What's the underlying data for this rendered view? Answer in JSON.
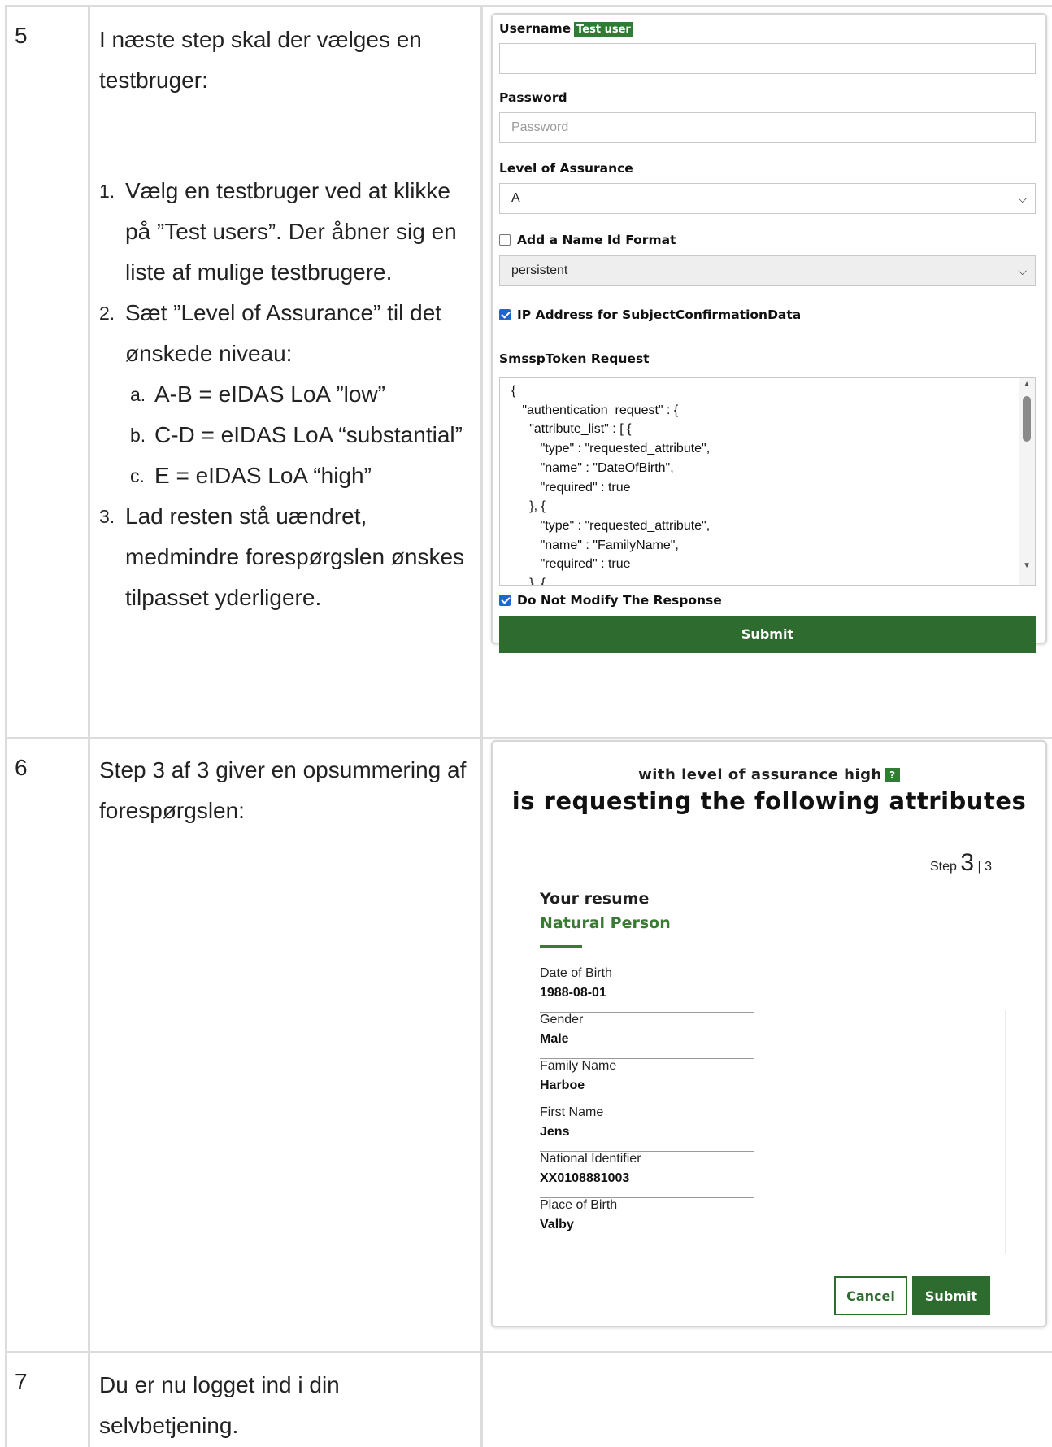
{
  "rows": [
    {
      "number": "5",
      "intro": "I næste step skal der vælges en testbruger:",
      "steps": [
        {
          "marker": "1.",
          "text": "Vælg en testbruger ved at klikke på ”Test users”. Der åbner sig en liste af mulige testbrugere."
        },
        {
          "marker": "2.",
          "text": "Sæt ”Level of Assurance” til det ønskede niveau:"
        },
        {
          "marker": "a.",
          "text": "A-B = eIDAS LoA ”low”"
        },
        {
          "marker": "b.",
          "text": "C-D = eIDAS LoA “substantial”"
        },
        {
          "marker": "c.",
          "text": "E = eIDAS LoA “high”"
        },
        {
          "marker": "3.",
          "text": "Lad resten stå uændret, medmindre forespørgslen ønskes tilpasset yderligere."
        }
      ]
    },
    {
      "number": "6",
      "intro": "Step 3 af 3 giver en opsummering af forespørgslen:"
    },
    {
      "number": "7",
      "intro": "Du er nu logget ind i din selvbetjening."
    }
  ],
  "login_form": {
    "username_label": "Username",
    "test_user_badge": "Test user",
    "username_value": "",
    "password_label": "Password",
    "password_placeholder": "Password",
    "loa_label": "Level of Assurance",
    "loa_value": "A",
    "name_id_label": "Add a Name Id Format",
    "name_id_checked": false,
    "name_id_value": "persistent",
    "ip_label": "IP Address for SubjectConfirmationData",
    "ip_checked": true,
    "token_label": "SmsspToken Request",
    "token_json": "{\n   \"authentication_request\" : {\n     \"attribute_list\" : [ {\n        \"type\" : \"requested_attribute\",\n        \"name\" : \"DateOfBirth\",\n        \"required\" : true\n     }, {\n        \"type\" : \"requested_attribute\",\n        \"name\" : \"FamilyName\",\n        \"required\" : true\n     }, {",
    "no_modify_label": "Do Not Modify The Response",
    "no_modify_checked": true,
    "submit_label": "Submit"
  },
  "resume": {
    "loa_line": "with level of assurance high",
    "help_badge": "?",
    "title": "is requesting the following attributes",
    "step_word": "Step",
    "step_current": "3",
    "step_total": "| 3",
    "heading": "Your resume",
    "subheading": "Natural Person",
    "attributes": [
      {
        "label": "Date of Birth",
        "value": "1988-08-01"
      },
      {
        "label": "Gender",
        "value": "Male"
      },
      {
        "label": "Family Name",
        "value": "Harboe"
      },
      {
        "label": "First Name",
        "value": "Jens"
      },
      {
        "label": "National Identifier",
        "value": "XX0108881003"
      },
      {
        "label": "Place of Birth",
        "value": "Valby"
      }
    ],
    "cancel_label": "Cancel",
    "submit_label": "Submit"
  }
}
